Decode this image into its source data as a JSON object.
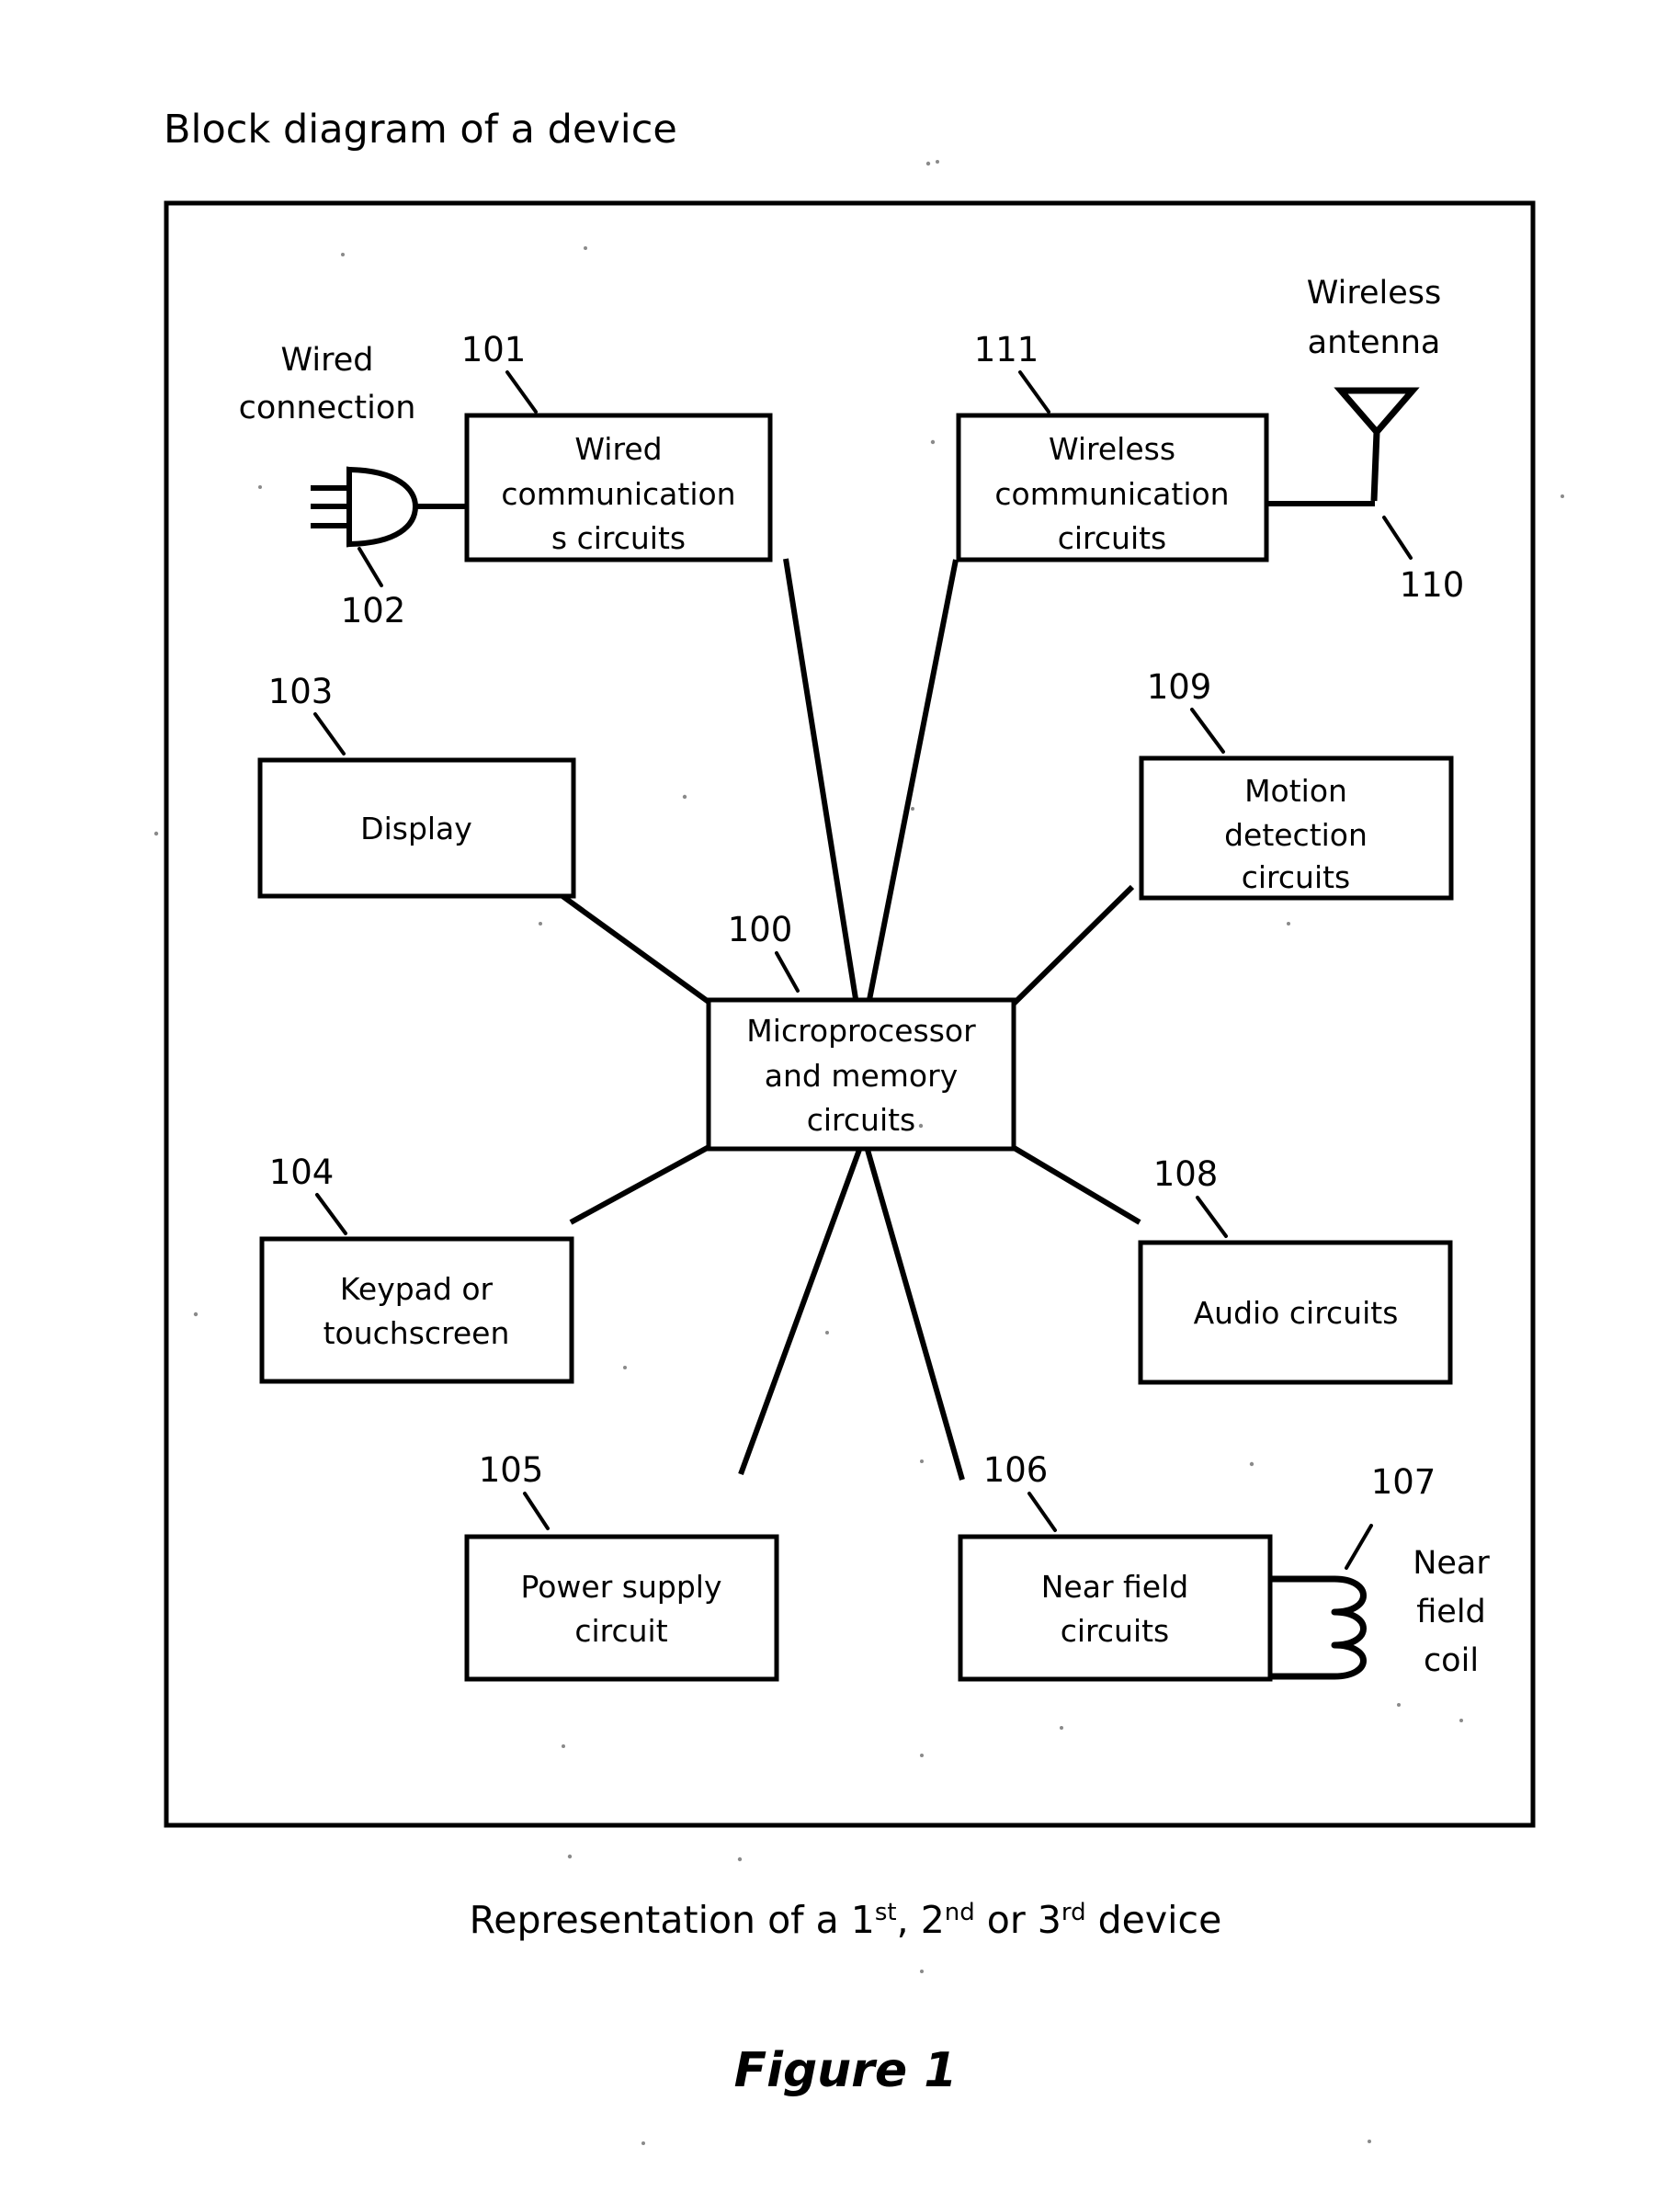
{
  "page": {
    "title": "Block diagram of a device",
    "caption": "Representation of a 1st, 2nd or 3rd device",
    "caption_parts": {
      "lead": "Representation of a 1",
      "sup1": "st",
      "mid1": ", 2",
      "sup2": "nd",
      "mid2": " or 3",
      "sup3": "rd",
      "tail": " device"
    },
    "figure_label": "Figure 1",
    "background_color": "#ffffff",
    "line_color": "#000000"
  },
  "diagram": {
    "type": "block-diagram",
    "hub": {
      "ref": "100",
      "label_lines": [
        "Microprocessor",
        "and memory",
        "circuits"
      ],
      "label": "Microprocessor and memory circuits"
    },
    "blocks": [
      {
        "ref": "101",
        "label": "Wired communications circuits",
        "label_lines": [
          "Wired",
          "communication",
          "s circuits"
        ],
        "position": "top-left"
      },
      {
        "ref": "111",
        "label": "Wireless communication circuits",
        "label_lines": [
          "Wireless",
          "communication",
          "circuits"
        ],
        "position": "top-right"
      },
      {
        "ref": "103",
        "label": "Display",
        "label_lines": [
          "Display"
        ],
        "position": "upper-left"
      },
      {
        "ref": "109",
        "label": "Motion detection circuits",
        "label_lines": [
          "Motion",
          "detection",
          "circuits"
        ],
        "position": "upper-right"
      },
      {
        "ref": "104",
        "label": "Keypad or touchscreen",
        "label_lines": [
          "Keypad or",
          "touchscreen"
        ],
        "position": "lower-left"
      },
      {
        "ref": "108",
        "label": "Audio circuits",
        "label_lines": [
          "Audio circuits"
        ],
        "position": "lower-right"
      },
      {
        "ref": "105",
        "label": "Power supply circuit",
        "label_lines": [
          "Power supply",
          "circuit"
        ],
        "position": "bottom-left"
      },
      {
        "ref": "106",
        "label": "Near field circuits",
        "label_lines": [
          "Near field",
          "circuits"
        ],
        "position": "bottom-right"
      }
    ],
    "external_elements": [
      {
        "ref": "102",
        "label": "Wired connection",
        "label_lines": [
          "Wired",
          "connection"
        ],
        "symbol": "plug-connector"
      },
      {
        "ref": "110",
        "label": "Wireless antenna",
        "label_lines": [
          "Wireless",
          "antenna"
        ],
        "symbol": "antenna"
      },
      {
        "ref": "107",
        "label": "Near field coil",
        "label_lines": [
          "Near",
          "field",
          "coil"
        ],
        "symbol": "inductor-coil"
      }
    ],
    "connections": [
      {
        "from": "102",
        "to": "101",
        "style": "straight-wire"
      },
      {
        "from": "111",
        "to": "110",
        "style": "straight-wire"
      },
      {
        "from": "106",
        "to": "107",
        "style": "coil-attached"
      },
      {
        "from": "101",
        "to": "100",
        "style": "spoke"
      },
      {
        "from": "111",
        "to": "100",
        "style": "spoke"
      },
      {
        "from": "103",
        "to": "100",
        "style": "spoke"
      },
      {
        "from": "109",
        "to": "100",
        "style": "spoke"
      },
      {
        "from": "104",
        "to": "100",
        "style": "spoke"
      },
      {
        "from": "108",
        "to": "100",
        "style": "spoke"
      },
      {
        "from": "105",
        "to": "100",
        "style": "spoke"
      },
      {
        "from": "106",
        "to": "100",
        "style": "spoke"
      }
    ]
  }
}
